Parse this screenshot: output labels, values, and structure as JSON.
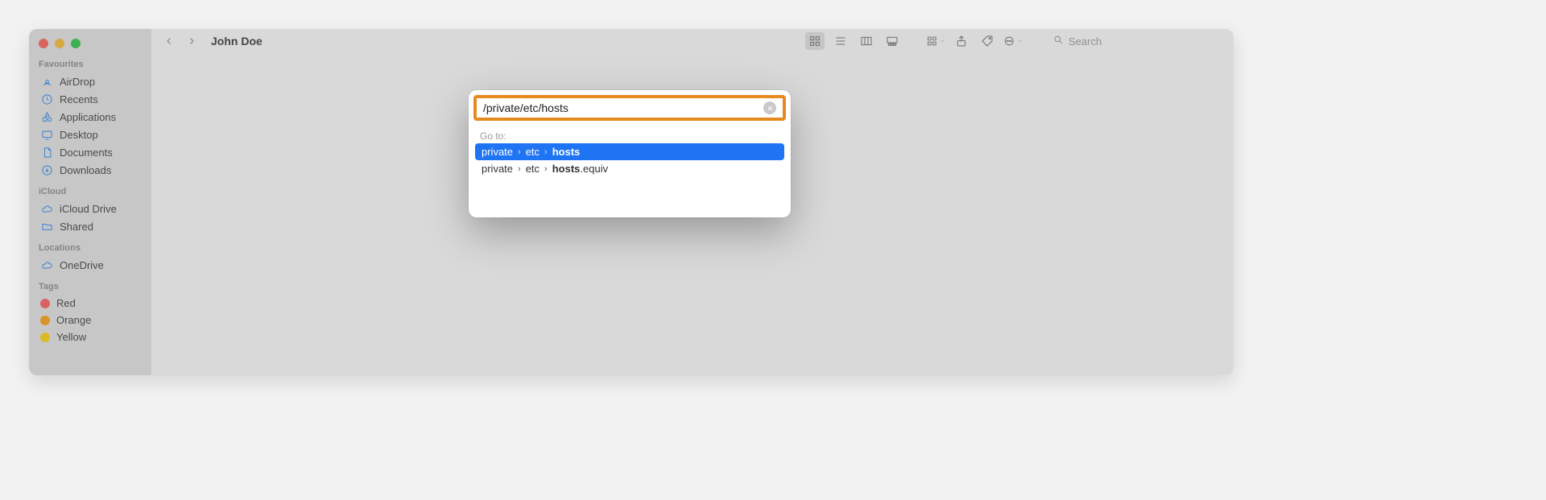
{
  "window_title": "John Doe",
  "sidebar": {
    "sections": [
      {
        "label": "Favourites",
        "items": [
          {
            "icon": "airdrop-icon",
            "label": "AirDrop"
          },
          {
            "icon": "clock-icon",
            "label": "Recents"
          },
          {
            "icon": "apps-icon",
            "label": "Applications"
          },
          {
            "icon": "desktop-icon",
            "label": "Desktop"
          },
          {
            "icon": "document-icon",
            "label": "Documents"
          },
          {
            "icon": "download-icon",
            "label": "Downloads"
          }
        ]
      },
      {
        "label": "iCloud",
        "items": [
          {
            "icon": "cloud-icon",
            "label": "iCloud Drive"
          },
          {
            "icon": "folder-icon",
            "label": "Shared"
          }
        ]
      },
      {
        "label": "Locations",
        "items": [
          {
            "icon": "cloud-icon",
            "label": "OneDrive"
          }
        ]
      },
      {
        "label": "Tags",
        "items": [
          {
            "icon": "tag-dot",
            "color": "#ff5b5b",
            "label": "Red"
          },
          {
            "icon": "tag-dot",
            "color": "#ff9f0a",
            "label": "Orange"
          },
          {
            "icon": "tag-dot",
            "color": "#ffd60a",
            "label": "Yellow"
          }
        ]
      }
    ]
  },
  "toolbar": {
    "search_placeholder": "Search"
  },
  "goto": {
    "input_value": "/private/etc/hosts",
    "heading": "Go to:",
    "rows": [
      {
        "selected": true,
        "segments": [
          "private",
          "etc"
        ],
        "match": "hosts",
        "suffix": ""
      },
      {
        "selected": false,
        "segments": [
          "private",
          "etc"
        ],
        "match": "hosts",
        "suffix": ".equiv"
      }
    ]
  }
}
